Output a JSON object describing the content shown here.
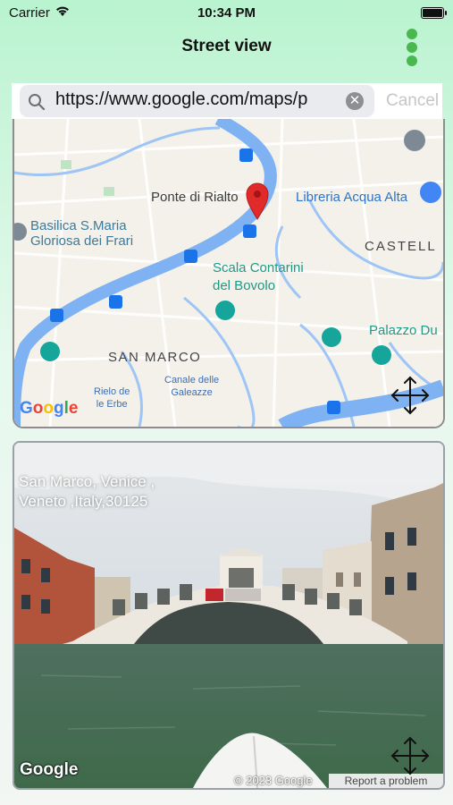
{
  "status_bar": {
    "carrier": "Carrier",
    "time": "10:34 PM"
  },
  "header": {
    "title": "Street view"
  },
  "search": {
    "value": "https://www.google.com/maps/p",
    "cancel_label": "Cancel"
  },
  "map": {
    "labels": {
      "rialto": "Ponte di Rialto",
      "libreria": "Libreria Acqua Alta",
      "basilica_line1": "Basilica S.Maria",
      "basilica_line2": "Gloriosa dei Frari",
      "castello": "CASTELL",
      "scala_line1": "Scala Contarini",
      "scala_line2": "del Bovolo",
      "palazzo": "Palazzo Du",
      "san_marco": "SAN MARCO",
      "rielo_line1": "Rielo de",
      "rielo_line2": "le Erbe",
      "canale_line1": "Canale delle",
      "canale_line2": "Galeazze"
    },
    "logo_text": "Google",
    "logo_colors": [
      "#4285f4",
      "#ea4335",
      "#fbbc05",
      "#4285f4",
      "#34a853",
      "#ea4335"
    ]
  },
  "street_view": {
    "address_line1": "San Marco, Venice ,",
    "address_line2": "Veneto ,Italy,30125",
    "logo_text": "Google",
    "copyright": "© 2023 Google",
    "report_link": "Report a problem"
  },
  "colors": {
    "accent_green": "#49b84f",
    "water": "#7fb2f3",
    "pin_red": "#e12b2b"
  }
}
